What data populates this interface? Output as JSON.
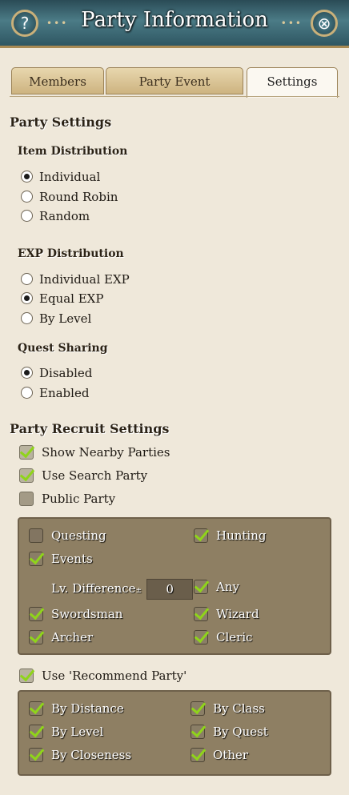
{
  "window": {
    "title": "Party Information",
    "help_glyph": "?",
    "close_glyph": "⊗",
    "deco_left": "•••",
    "deco_right": "•••"
  },
  "tabs": [
    {
      "label": "Members",
      "active": false
    },
    {
      "label": "Party Event",
      "active": false
    },
    {
      "label": "Settings",
      "active": true
    }
  ],
  "party_settings": {
    "heading": "Party Settings",
    "item_distribution": {
      "label": "Item Distribution",
      "options": [
        "Individual",
        "Round Robin",
        "Random"
      ],
      "selected": "Individual"
    },
    "exp_distribution": {
      "label": "EXP Distribution",
      "options": [
        "Individual EXP",
        "Equal EXP",
        "By Level"
      ],
      "selected": "Equal EXP"
    },
    "quest_sharing": {
      "label": "Quest Sharing",
      "options": [
        "Disabled",
        "Enabled"
      ],
      "selected": "Disabled"
    }
  },
  "recruit": {
    "heading": "Party Recruit Settings",
    "show_nearby": {
      "label": "Show Nearby Parties",
      "checked": true
    },
    "use_search": {
      "label": "Use Search Party",
      "checked": true
    },
    "public_party": {
      "label": "Public Party",
      "checked": false
    },
    "filters": {
      "questing": {
        "label": "Questing",
        "checked": false
      },
      "hunting": {
        "label": "Hunting",
        "checked": true
      },
      "events": {
        "label": "Events",
        "checked": true
      },
      "lv_difference_label": "Lv. Difference",
      "lv_difference_value": "0",
      "any": {
        "label": "Any",
        "checked": true
      },
      "swordsman": {
        "label": "Swordsman",
        "checked": true
      },
      "wizard": {
        "label": "Wizard",
        "checked": true
      },
      "archer": {
        "label": "Archer",
        "checked": true
      },
      "cleric": {
        "label": "Cleric",
        "checked": true
      }
    },
    "recommend": {
      "label": "Use 'Recommend Party'",
      "checked": true
    },
    "recommend_options": {
      "by_distance": {
        "label": "By Distance",
        "checked": true
      },
      "by_class": {
        "label": "By Class",
        "checked": true
      },
      "by_level": {
        "label": "By Level",
        "checked": true
      },
      "by_quest": {
        "label": "By Quest",
        "checked": true
      },
      "by_closeness": {
        "label": "By Closeness",
        "checked": true
      },
      "other": {
        "label": "Other",
        "checked": true
      }
    }
  },
  "colors": {
    "title_bar": "#3b6470",
    "panel_bg": "#efe8da",
    "group_box": "#8e7f63",
    "check_mark": "#8fd41a"
  }
}
